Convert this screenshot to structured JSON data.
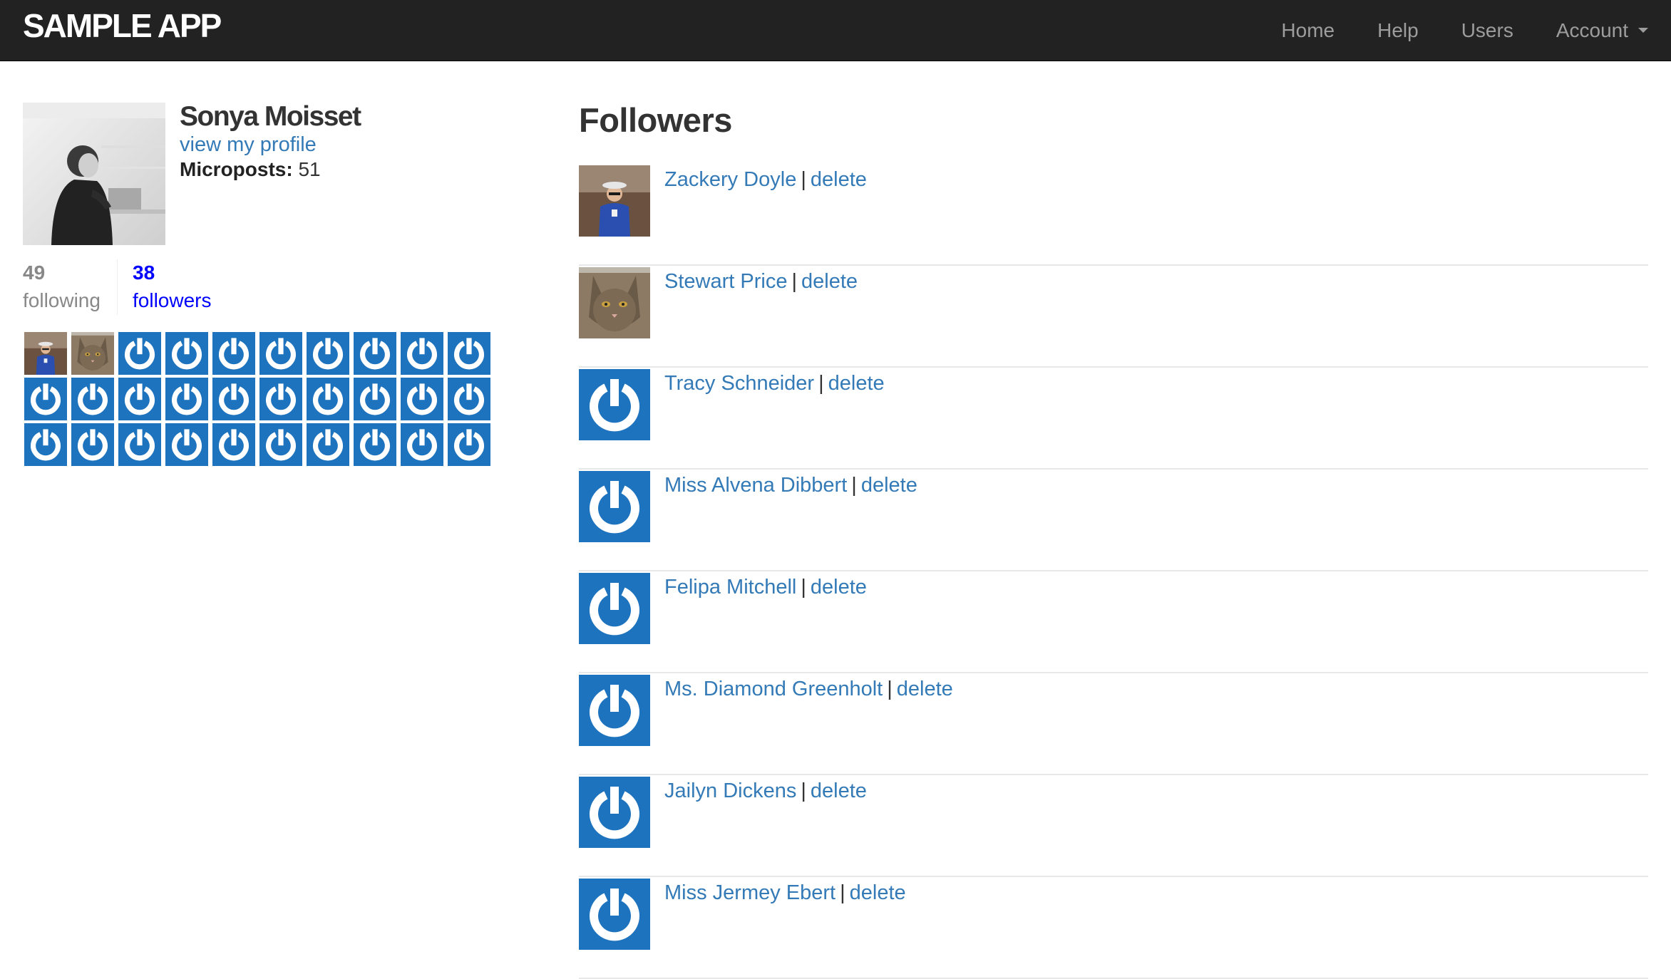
{
  "navbar": {
    "logo": "SAMPLE APP",
    "links": {
      "home": "Home",
      "help": "Help",
      "users": "Users",
      "account": "Account"
    },
    "icons": {
      "account_caret": "caret-down-icon"
    }
  },
  "sidebar": {
    "user_name": "Sonya Moisset",
    "view_profile_label": "view my profile",
    "microposts_label": "Microposts:",
    "microposts_count": "51",
    "stats": {
      "following_count": "49",
      "following_label": "following",
      "followers_count": "38",
      "followers_label": "followers"
    },
    "follower_avatars": [
      "photo-person",
      "photo-cat",
      "power-icon",
      "power-icon",
      "power-icon",
      "power-icon",
      "power-icon",
      "power-icon",
      "power-icon",
      "power-icon",
      "power-icon",
      "power-icon",
      "power-icon",
      "power-icon",
      "power-icon",
      "power-icon",
      "power-icon",
      "power-icon",
      "power-icon",
      "power-icon",
      "power-icon",
      "power-icon",
      "power-icon",
      "power-icon",
      "power-icon",
      "power-icon",
      "power-icon",
      "power-icon",
      "power-icon",
      "power-icon"
    ]
  },
  "main": {
    "title": "Followers",
    "delete_label": "delete",
    "separator": "|",
    "followers": [
      {
        "name": "Zackery Doyle",
        "avatar": "photo-person"
      },
      {
        "name": "Stewart Price",
        "avatar": "photo-cat"
      },
      {
        "name": "Tracy Schneider",
        "avatar": "power-icon"
      },
      {
        "name": "Miss Alvena Dibbert",
        "avatar": "power-icon"
      },
      {
        "name": "Felipa Mitchell",
        "avatar": "power-icon"
      },
      {
        "name": "Ms. Diamond Greenholt",
        "avatar": "power-icon"
      },
      {
        "name": "Jailyn Dickens",
        "avatar": "power-icon"
      },
      {
        "name": "Miss Jermey Ebert",
        "avatar": "power-icon"
      }
    ]
  },
  "colors": {
    "navbar_bg": "#222222",
    "nav_link": "#9d9d9d",
    "link": "#337ab7",
    "gravatar_blue": "#1e73be",
    "followers_stat": "#0000ff",
    "following_stat": "#888888"
  }
}
